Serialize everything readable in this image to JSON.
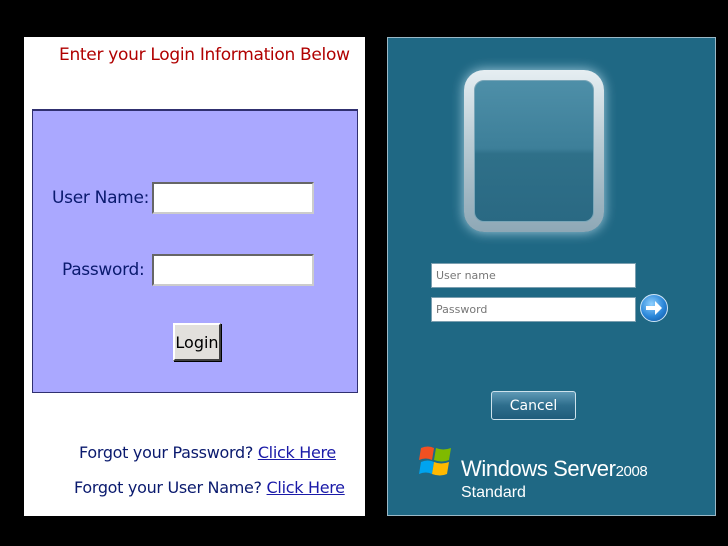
{
  "web_login": {
    "title": "Enter your Login Information Below",
    "username_label": "User Name:",
    "password_label": "Password:",
    "username_value": "",
    "password_value": "",
    "login_button": "Login",
    "forgot_password_text": "Forgot your Password?",
    "forgot_password_link": "Click Here",
    "forgot_username_text": "Forgot your User Name?",
    "forgot_username_link": "Click Here"
  },
  "windows_logon": {
    "username_placeholder": "User name",
    "password_placeholder": "Password",
    "submit_icon": "arrow-right-icon",
    "cancel_button": "Cancel",
    "brand_name": "Windows Server",
    "brand_year": "2008",
    "edition": "Standard",
    "logo_icon": "windows-flag-icon"
  },
  "colors": {
    "page_background": "#000000",
    "form_box": "#aaa8ff",
    "title_red": "#b00000",
    "label_navy": "#0a1a6e",
    "windows_background": "#1f6884"
  }
}
